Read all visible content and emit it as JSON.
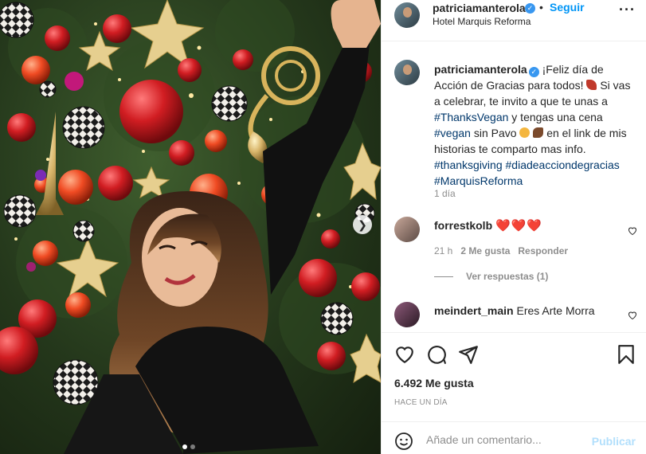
{
  "post": {
    "author": "patriciamanterola",
    "follow_label": "Seguir",
    "separator": "•",
    "location": "Hotel Marquis Reforma",
    "more_label": "···"
  },
  "caption": {
    "author": "patriciamanterola",
    "part1": "¡Feliz día de Acción de Gracias para todos! ",
    "part2": " Si vas a celebrar, te invito a que te unas a ",
    "tag_thanksvegan": "#ThanksVegan",
    "part3": " y tengas una cena ",
    "tag_vegan": "#vegan",
    "part4": " sin Pavo ",
    "part5": " en el link de mis historias te comparto mas info. ",
    "tag_thanksgiving": "#thanksgiving",
    "tag_diadeaccion": "#diadeacciondegracias",
    "tag_marquis": "#MarquisReforma",
    "time": "1 día"
  },
  "comments": [
    {
      "user": "forrestkolb",
      "text": "❤️❤️❤️",
      "time": "21 h",
      "likes": "2 Me gusta",
      "reply": "Responder"
    },
    {
      "user": "meindert_main",
      "text": "Eres Arte Morra"
    }
  ],
  "view_replies": "Ver respuestas (1)",
  "likes": "6.492 Me gusta",
  "timeago": "HACE UN DÍA",
  "composer": {
    "placeholder": "Añade un comentario...",
    "publish": "Publicar"
  },
  "carousel": {
    "count": 2,
    "active": 0
  },
  "colors": {
    "link": "#00376b",
    "accent": "#0095f6",
    "heart": "#ed4956",
    "muted": "#8e8e8e"
  },
  "icons": [
    "verified-badge-icon",
    "more-options-icon",
    "heart-icon",
    "comment-icon",
    "share-icon",
    "bookmark-icon",
    "emoji-icon",
    "next-arrow-icon"
  ]
}
